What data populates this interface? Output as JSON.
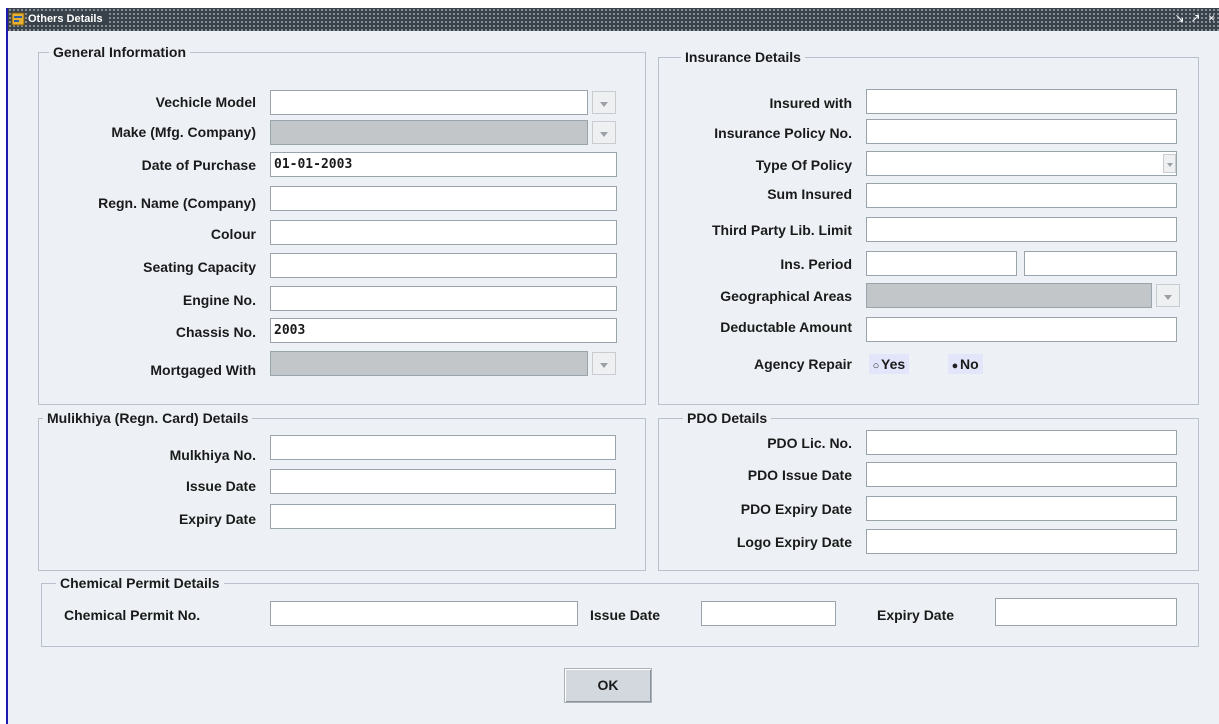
{
  "window": {
    "title": "Others Details",
    "controls": [
      "↘",
      "↗",
      "×"
    ]
  },
  "general": {
    "title": "General Information",
    "fields": [
      {
        "label": "Vechicle Model",
        "value": ""
      },
      {
        "label": "Make (Mfg. Company)",
        "value": ""
      },
      {
        "label": "Date of Purchase",
        "value": "01-01-2003"
      },
      {
        "label": "Regn. Name (Company)",
        "value": ""
      },
      {
        "label": "Colour",
        "value": ""
      },
      {
        "label": "Seating Capacity",
        "value": ""
      },
      {
        "label": "Engine No.",
        "value": ""
      },
      {
        "label": "Chassis No.",
        "value": "2003"
      },
      {
        "label": "Mortgaged With",
        "value": ""
      }
    ]
  },
  "insurance": {
    "title": "Insurance Details",
    "fields": [
      {
        "label": "Insured with",
        "value": ""
      },
      {
        "label": "Insurance Policy No.",
        "value": ""
      },
      {
        "label": "Type Of Policy",
        "value": ""
      },
      {
        "label": "Sum Insured",
        "value": ""
      },
      {
        "label": "Third Party Lib. Limit",
        "value": ""
      },
      {
        "label": "Ins. Period",
        "value": "",
        "value2": ""
      },
      {
        "label": "Geographical Areas",
        "value": ""
      },
      {
        "label": "Deductable Amount",
        "value": ""
      },
      {
        "label": "Agency Repair"
      }
    ],
    "agency_repair": {
      "options": [
        "Yes",
        "No"
      ],
      "selected": "No"
    }
  },
  "mulkhiya": {
    "title": "Mulikhiya (Regn. Card) Details",
    "fields": [
      {
        "label": "Mulkhiya No.",
        "value": ""
      },
      {
        "label": "Issue Date",
        "value": ""
      },
      {
        "label": "Expiry Date",
        "value": ""
      }
    ]
  },
  "pdo": {
    "title": "PDO Details",
    "fields": [
      {
        "label": "PDO Lic. No.",
        "value": ""
      },
      {
        "label": "PDO Issue Date",
        "value": ""
      },
      {
        "label": "PDO Expiry Date",
        "value": ""
      },
      {
        "label": "Logo Expiry Date",
        "value": ""
      }
    ]
  },
  "chemical": {
    "title": "Chemical Permit Details",
    "permit_label": "Chemical Permit No.",
    "permit_value": "",
    "issue_label": "Issue Date",
    "issue_value": "",
    "expiry_label": "Expiry Date",
    "expiry_value": ""
  },
  "ok_label": "OK",
  "colors": {
    "titlebar": "#39424a",
    "window_bg": "#edf1f6",
    "disabled_field": "#c3c6c9",
    "radio_bg": "#e3e6fb",
    "left_accent": "#1b1bb0"
  }
}
